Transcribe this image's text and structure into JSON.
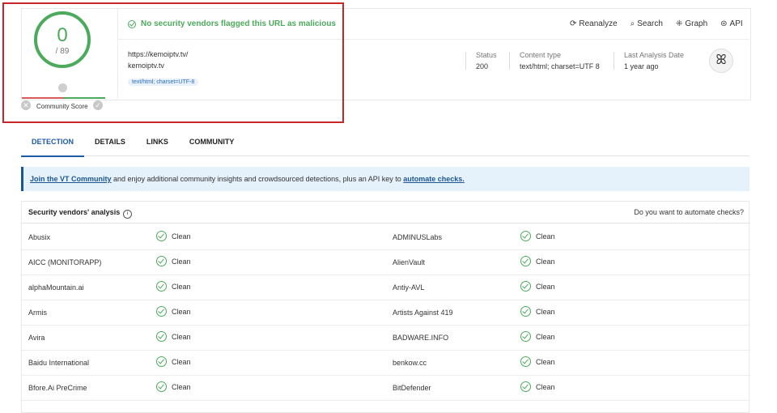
{
  "header": {
    "score": "0",
    "score_total": "/ 89",
    "community_label": "Community Score",
    "verdict": "No security vendors flagged this URL as malicious",
    "url": "https://kemoiptv.tv/",
    "domain": "kemoiptv.tv",
    "content_tag": "text/html; charset=UTF-8",
    "actions": [
      {
        "icon": "refresh-icon",
        "label": "Reanalyze"
      },
      {
        "icon": "search-icon",
        "label": "Search"
      },
      {
        "icon": "graph-icon",
        "label": "Graph"
      },
      {
        "icon": "api-icon",
        "label": "API"
      }
    ],
    "stats": [
      {
        "label": "Status",
        "value": "200"
      },
      {
        "label": "Content type",
        "value": "text/html; charset=UTF 8"
      },
      {
        "label": "Last Analysis Date",
        "value": "1 year ago"
      }
    ]
  },
  "tabs": [
    "DETECTION",
    "DETAILS",
    "LINKS",
    "COMMUNITY"
  ],
  "banner": {
    "link1": "Join the VT Community",
    "text": " and enjoy additional community insights and crowdsourced detections, plus an API key to ",
    "link2": "automate checks."
  },
  "table": {
    "title": "Security vendors' analysis",
    "right_text": "Do you want to automate checks?",
    "rows": [
      {
        "left": "Abusix",
        "left_result": "Clean",
        "right": "ADMINUSLabs",
        "right_result": "Clean"
      },
      {
        "left": "AICC (MONITORAPP)",
        "left_result": "Clean",
        "right": "AlienVault",
        "right_result": "Clean"
      },
      {
        "left": "alphaMountain.ai",
        "left_result": "Clean",
        "right": "Antiy-AVL",
        "right_result": "Clean"
      },
      {
        "left": "Armis",
        "left_result": "Clean",
        "right": "Artists Against 419",
        "right_result": "Clean"
      },
      {
        "left": "Avira",
        "left_result": "Clean",
        "right": "BADWARE.INFO",
        "right_result": "Clean"
      },
      {
        "left": "Baidu International",
        "left_result": "Clean",
        "right": "benkow.cc",
        "right_result": "Clean"
      },
      {
        "left": "Bfore.Ai PreCrime",
        "left_result": "Clean",
        "right": "BitDefender",
        "right_result": "Clean"
      }
    ]
  },
  "colors": {
    "accent": "#1f5aa6",
    "clean": "#4caa5c",
    "highlight": "#c62828"
  }
}
